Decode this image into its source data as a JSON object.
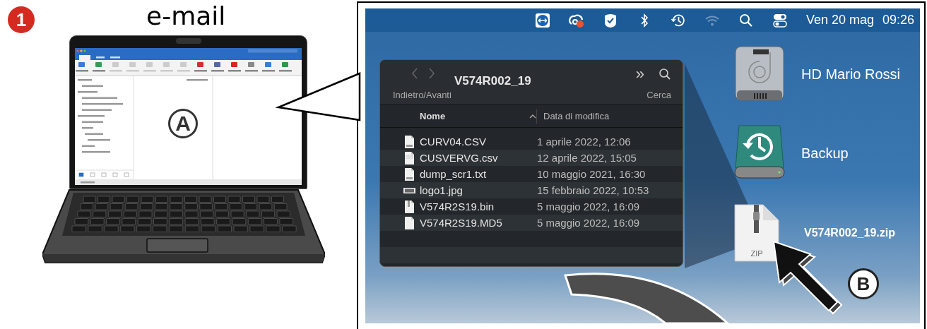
{
  "step": {
    "number": "1",
    "title": "e-mail"
  },
  "markers": {
    "a": "A",
    "b": "B"
  },
  "menubar": {
    "date": "Ven 20 mag",
    "time": "09:26"
  },
  "finder": {
    "title": "V574R002_19",
    "nav_label": "Indietro/Avanti",
    "search_label": "Cerca",
    "more": "»",
    "columns": [
      {
        "label": "Nome",
        "sorted": true
      },
      {
        "label": "Data di modifica",
        "sorted": false
      }
    ],
    "files": [
      {
        "name": "CURV04.CSV",
        "date": "1 aprile 2022, 12:06",
        "kind": "document"
      },
      {
        "name": "CUSVERVG.csv",
        "date": "12 aprile 2022, 15:05",
        "kind": "spreadsheet"
      },
      {
        "name": "dump_scr1.txt",
        "date": "10 maggio 2021, 16:30",
        "kind": "document"
      },
      {
        "name": "logo1.jpg",
        "date": "15 febbraio 2022, 10:53",
        "kind": "image"
      },
      {
        "name": "V574R2S19.bin",
        "date": "5 maggio 2022, 16:09",
        "kind": "binary"
      },
      {
        "name": "V574R2S19.MD5",
        "date": "5 maggio 2022, 16:09",
        "kind": "blank"
      }
    ]
  },
  "desktop": [
    {
      "label": "HD Mario Rossi",
      "kind": "drive"
    },
    {
      "label": "Backup",
      "kind": "backup"
    },
    {
      "label": "V574R002_19.zip",
      "kind": "archive",
      "badge": "ZIP"
    }
  ]
}
